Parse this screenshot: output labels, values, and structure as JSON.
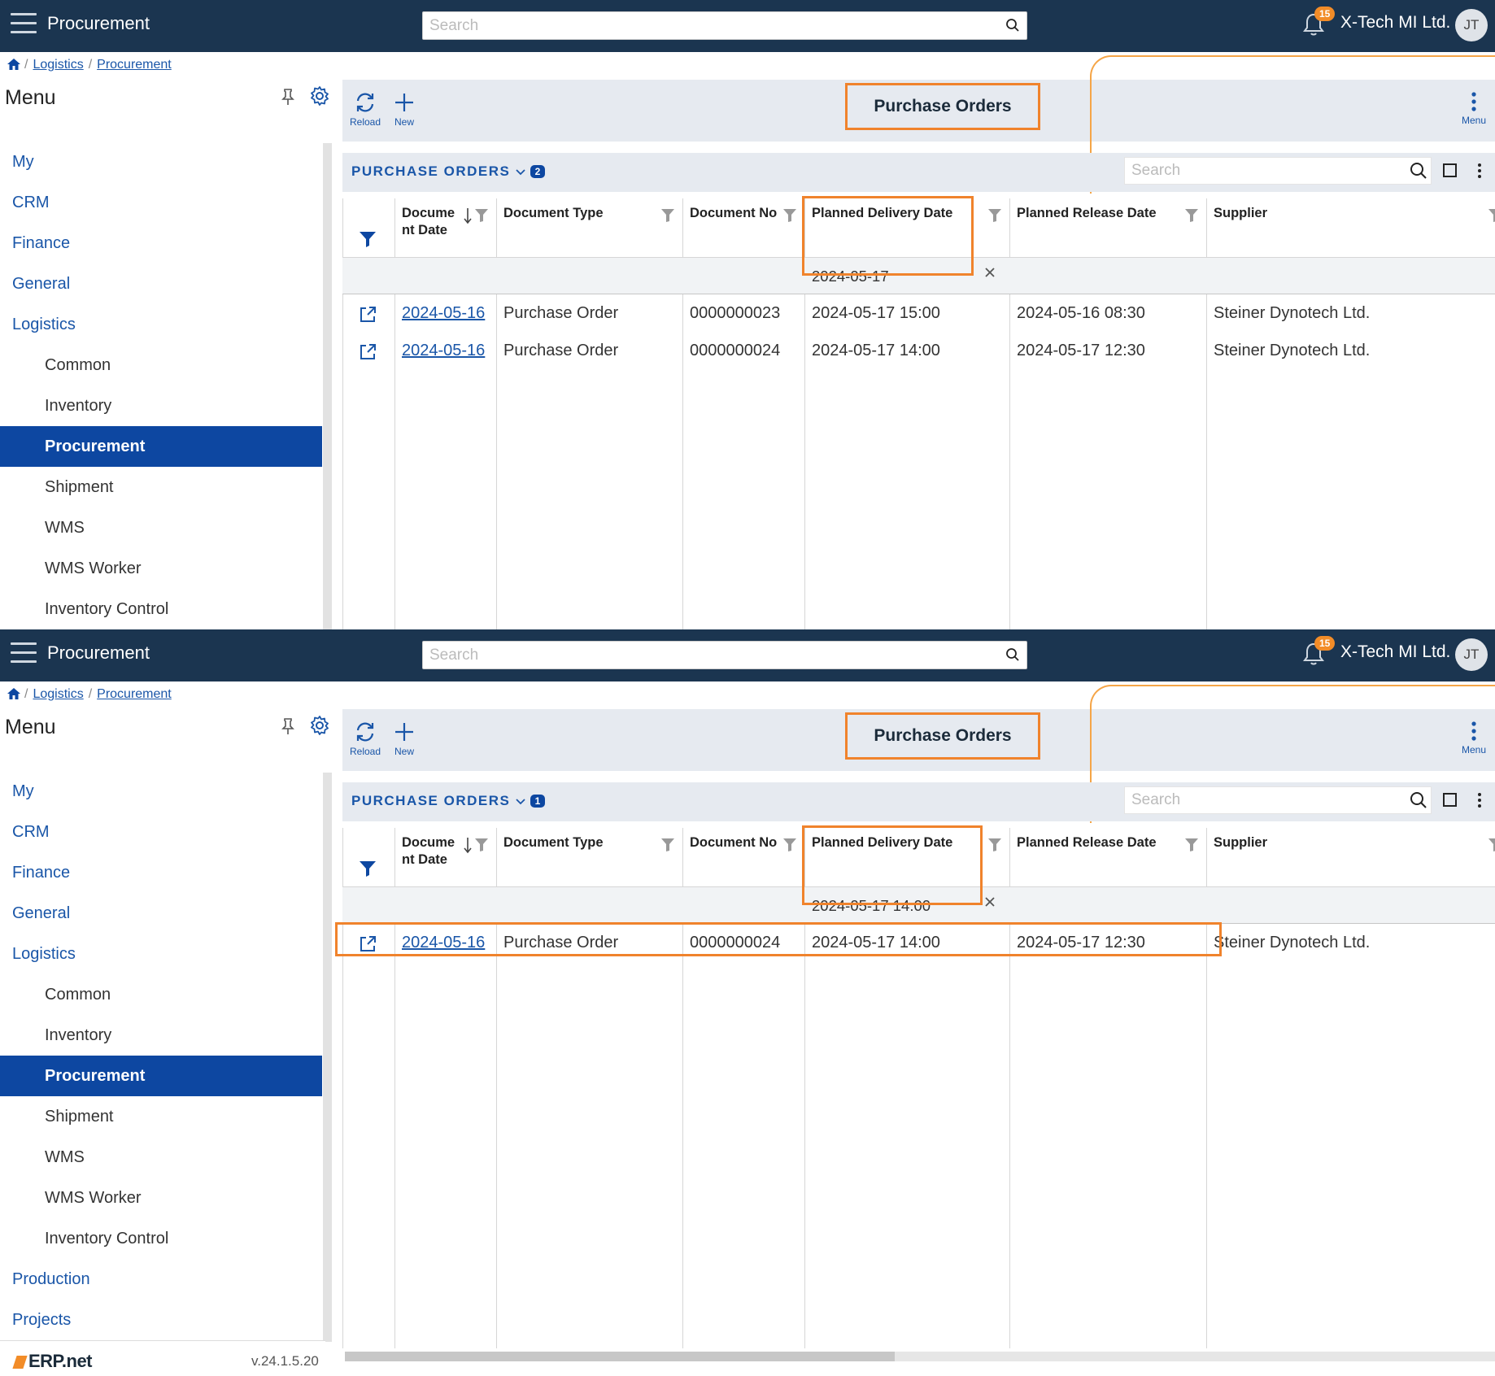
{
  "app": {
    "title": "Procurement",
    "search_placeholder": "Search",
    "notifications_count": "15",
    "company": "X-Tech MI Ltd.",
    "user_initials": "JT"
  },
  "breadcrumb": {
    "level1": "Logistics",
    "level2": "Procurement"
  },
  "sidebar": {
    "header": "Menu",
    "items": [
      "My",
      "CRM",
      "Finance",
      "General",
      "Logistics"
    ],
    "sub_items": [
      "Common",
      "Inventory",
      "Procurement",
      "Shipment",
      "WMS",
      "WMS Worker",
      "Inventory Control"
    ],
    "bottom_items": [
      "Production",
      "Projects"
    ],
    "active": "Procurement"
  },
  "toolbar": {
    "reload_label": "Reload",
    "new_label": "New",
    "title": "Purchase Orders",
    "menu_label": "Menu"
  },
  "grid": {
    "title": "PURCHASE ORDERS",
    "search_placeholder": "Search",
    "columns": [
      "Docume\nnt Date",
      "Document Type",
      "Document No",
      "Planned Delivery Date",
      "Planned Release Date",
      "Supplier"
    ]
  },
  "screens": [
    {
      "count": "2",
      "filter_value": "2024-05-17",
      "rows": [
        {
          "document_date": "2024-05-16",
          "document_type": "Purchase Order",
          "document_no": "0000000023",
          "planned_delivery": "2024-05-17 15:00",
          "planned_release": "2024-05-16 08:30",
          "supplier": "Steiner Dynotech Ltd."
        },
        {
          "document_date": "2024-05-16",
          "document_type": "Purchase Order",
          "document_no": "0000000024",
          "planned_delivery": "2024-05-17 14:00",
          "planned_release": "2024-05-17 12:30",
          "supplier": "Steiner Dynotech Ltd."
        }
      ]
    },
    {
      "count": "1",
      "filter_value": "2024-05-17 14:00",
      "rows": [
        {
          "document_date": "2024-05-16",
          "document_type": "Purchase Order",
          "document_no": "0000000024",
          "planned_delivery": "2024-05-17 14:00",
          "planned_release": "2024-05-17 12:30",
          "supplier": "Steiner Dynotech Ltd."
        }
      ]
    }
  ],
  "footer": {
    "logo": "ERP.net",
    "version": "v.24.1.5.20"
  },
  "colors": {
    "topbar": "#1b3550",
    "accent": "#1a56a8",
    "active": "#0d47a1",
    "highlight": "#f0832c",
    "badge": "#f28c28"
  },
  "icons": [
    "hamburger-icon",
    "search-icon",
    "bell-icon",
    "home-icon",
    "pin-icon",
    "gear-icon",
    "reload-icon",
    "plus-icon",
    "kebab-icon",
    "chevron-down-icon",
    "filter-icon",
    "sort-down-icon",
    "open-external-icon",
    "clear-icon",
    "square-icon"
  ]
}
